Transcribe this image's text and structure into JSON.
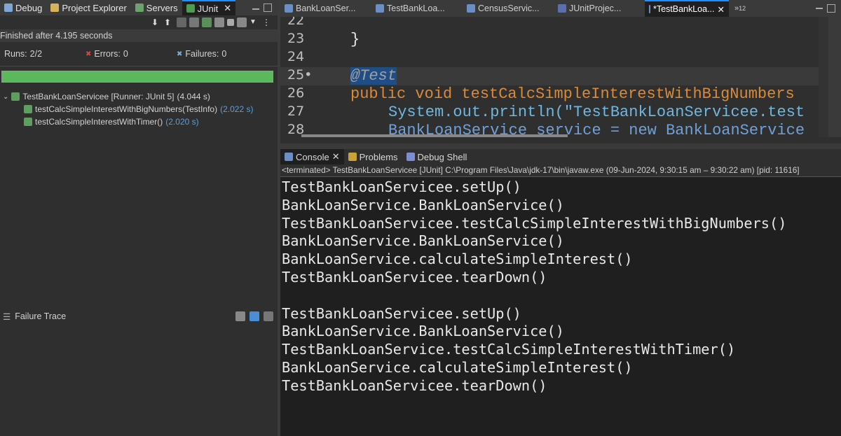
{
  "left_tabs": [
    {
      "label": "Debug",
      "icon": "debug-icon"
    },
    {
      "label": "Project Explorer",
      "icon": "project-explorer-icon"
    },
    {
      "label": "Servers",
      "icon": "servers-icon"
    },
    {
      "label": "JUnit",
      "icon": "junit-icon",
      "active": true
    }
  ],
  "junit": {
    "status": "Finished after 4.195 seconds",
    "runs_label": "Runs:",
    "runs_value": "2/2",
    "errors_label": "Errors:",
    "errors_value": "0",
    "failures_label": "Failures:",
    "failures_value": "0",
    "progress_fraction": 1.0,
    "bar_color": "#5cb85c",
    "suite": {
      "name": "TestBankLoanServicee [Runner: JUnit 5]",
      "duration": "(4.044 s)"
    },
    "tests": [
      {
        "name": "testCalcSimpleInterestWithBigNumbers(TestInfo)",
        "duration": "(2.022 s)"
      },
      {
        "name": "testCalcSimpleInterestWithTimer()",
        "duration": "(2.020 s)"
      }
    ],
    "failure_trace_label": "Failure Trace"
  },
  "editor": {
    "tabs": [
      {
        "label": "BankLoanSer..."
      },
      {
        "label": "TestBankLoa..."
      },
      {
        "label": "CensusServic..."
      },
      {
        "label": "JUnitProjec..."
      },
      {
        "label": "*TestBankLoa...",
        "active": true
      }
    ],
    "overflow_count": "12",
    "lines": [
      {
        "n": "22",
        "code": ""
      },
      {
        "n": "23",
        "code": "}"
      },
      {
        "n": "24",
        "code": ""
      },
      {
        "n": "25•",
        "code": "@Test"
      },
      {
        "n": "26",
        "code": "public void testCalcSimpleInterestWithBigNumbers"
      },
      {
        "n": "27",
        "code": "System.out.println(\"TestBankLoanServicee.test"
      },
      {
        "n": "28",
        "code": "BankLoanService service = new BankLoanService"
      }
    ]
  },
  "console": {
    "tabs": [
      {
        "label": "Console",
        "active": true
      },
      {
        "label": "Problems"
      },
      {
        "label": "Debug Shell"
      }
    ],
    "terminated": "<terminated> TestBankLoanServicee [JUnit] C:\\Program Files\\Java\\jdk-17\\bin\\javaw.exe  (09-Jun-2024, 9:30:15 am – 9:30:22 am) [pid: 11616]",
    "output": [
      "TestBankLoanServicee.setUp()",
      "BankLoanService.BankLoanService()",
      "TestBankLoanServicee.testCalcSimpleInterestWithBigNumbers()",
      "BankLoanService.BankLoanService()",
      "BankLoanService.calculateSimpleInterest()",
      "TestBankLoanServicee.tearDown()",
      "",
      "TestBankLoanServicee.setUp()",
      "BankLoanService.BankLoanService()",
      "TestBankLoanService.testCalcSimpleInterestWithTimer()",
      "BankLoanService.calculateSimpleInterest()",
      "TestBankLoanServicee.tearDown()"
    ]
  }
}
